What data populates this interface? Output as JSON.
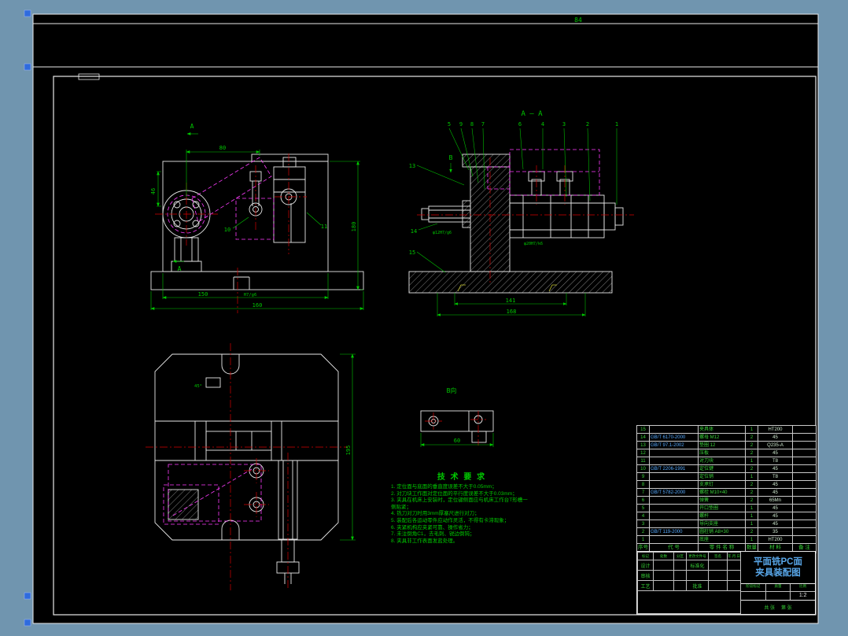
{
  "palette": {
    "background": "#7095af",
    "line": "#e8e8e8",
    "dimension_green": "#00c800",
    "phantom_magenta": "#ff3dff",
    "centerline_red": "#d40000",
    "title_blue": "#58a6e8",
    "grip_blue": "#2f6bdd"
  },
  "sheet": {
    "top_dim": "84"
  },
  "front_view": {
    "mark_top": "A",
    "mark_bottom": "A",
    "dim_top": "80",
    "dim_left": "46",
    "dim_right": "180",
    "dim_bottom_inner": "150",
    "dim_bottom_outer": "160",
    "fit": "H7/g6",
    "balloon_10": "10",
    "balloon_11": "11"
  },
  "section_view": {
    "label": "A — A",
    "balloons": [
      "5",
      "9",
      "8",
      "7",
      "6",
      "4",
      "3",
      "2",
      "1"
    ],
    "balloon_13": "13",
    "balloon_14": "14",
    "balloon_15": "15",
    "view_arrow": "B",
    "dim_inner": "141",
    "dim_outer": "168",
    "fit1": "φ12H7/g6",
    "fit2": "φ20H7/k6"
  },
  "plan_view": {
    "dim_right": "195",
    "angle": "45°"
  },
  "b_view": {
    "label": "B向",
    "dim": "60"
  },
  "tech": {
    "title": "技 术 要 求",
    "items": [
      "1. 定位面与底面的垂直度误差不大于0.05mm；",
      "2. 对刀块工作面对定位面的平行度误差不大于0.03mm；",
      "3. 夹具在机床上安装时，定位键侧面应与机床工作台T形槽一侧贴紧；",
      "4. 铣刀对刀时用3mm厚塞尺进行对刀；",
      "5. 装配后各运动零件应动作灵活，不得有卡滞现象；",
      "6. 夹紧机构应夹紧可靠、操作省力；",
      "7. 未注倒角C1，去毛刺、锐边倒钝；",
      "8. 夹具非工作表面发蓝处理。"
    ]
  },
  "bom": {
    "headers": [
      "序号",
      "代  号",
      "零 件 名 称",
      "数量",
      "材  料",
      "备 注"
    ],
    "rows": [
      {
        "no": "15",
        "code": "",
        "name": "夹具体",
        "qty": "1",
        "mat": "HT200",
        "note": ""
      },
      {
        "no": "14",
        "code": "GB/T 6170-2000",
        "name": "螺母 M12",
        "qty": "2",
        "mat": "45",
        "note": ""
      },
      {
        "no": "13",
        "code": "GB/T 97.1-2002",
        "name": "垫圈 12",
        "qty": "2",
        "mat": "Q235-A",
        "note": ""
      },
      {
        "no": "12",
        "code": "",
        "name": "压板",
        "qty": "2",
        "mat": "45",
        "note": ""
      },
      {
        "no": "11",
        "code": "",
        "name": "对刀块",
        "qty": "1",
        "mat": "T8",
        "note": ""
      },
      {
        "no": "10",
        "code": "GB/T 2206-1991",
        "name": "定位键",
        "qty": "2",
        "mat": "45",
        "note": ""
      },
      {
        "no": "9",
        "code": "",
        "name": "定位销",
        "qty": "1",
        "mat": "T8",
        "note": ""
      },
      {
        "no": "8",
        "code": "",
        "name": "支承钉",
        "qty": "2",
        "mat": "45",
        "note": ""
      },
      {
        "no": "7",
        "code": "GB/T 5782-2000",
        "name": "螺栓 M10×40",
        "qty": "2",
        "mat": "45",
        "note": ""
      },
      {
        "no": "6",
        "code": "",
        "name": "弹簧",
        "qty": "2",
        "mat": "65Mn",
        "note": ""
      },
      {
        "no": "5",
        "code": "",
        "name": "开口垫圈",
        "qty": "1",
        "mat": "45",
        "note": ""
      },
      {
        "no": "4",
        "code": "",
        "name": "螺杆",
        "qty": "1",
        "mat": "45",
        "note": ""
      },
      {
        "no": "3",
        "code": "",
        "name": "导向支座",
        "qty": "1",
        "mat": "45",
        "note": ""
      },
      {
        "no": "2",
        "code": "GB/T 119-2000",
        "name": "圆柱销 A8×30",
        "qty": "2",
        "mat": "35",
        "note": ""
      },
      {
        "no": "1",
        "code": "",
        "name": "底座",
        "qty": "1",
        "mat": "HT200",
        "note": ""
      }
    ]
  },
  "titleblock": {
    "row_labels": [
      "标记",
      "处数",
      "分区",
      "更改文件号",
      "签名",
      "年.月.日"
    ],
    "design": "设计",
    "standard": "标准化",
    "check": "审核",
    "process": "工艺",
    "approve": "批准",
    "stage": "阶段标记",
    "weight": "质量",
    "scale": "比例",
    "scale_value": "1:2",
    "sheet_total": "共 张",
    "sheet_no": "第 张",
    "title_line1": "平面铣PC面",
    "title_line2": "夹具装配图"
  }
}
